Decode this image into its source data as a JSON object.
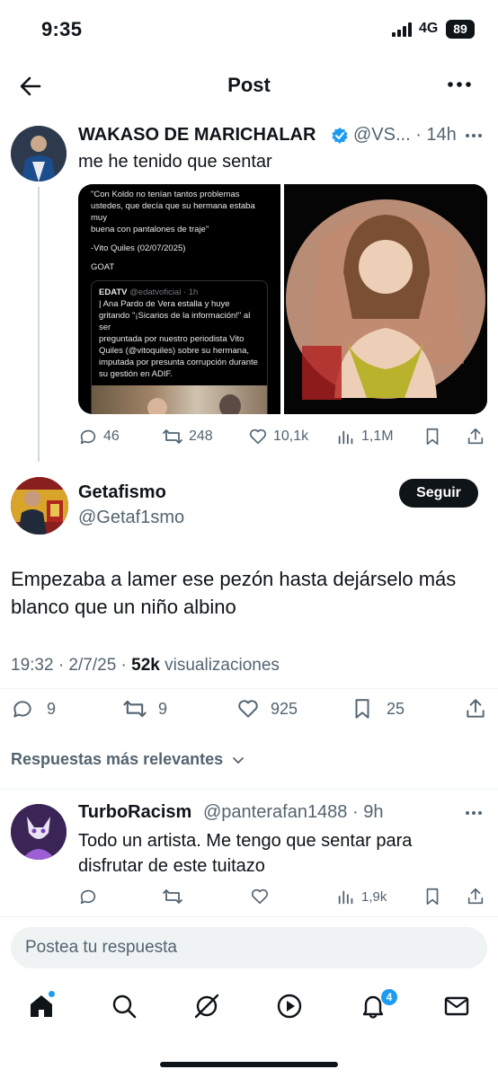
{
  "status_bar": {
    "time": "9:35",
    "network": "4G",
    "battery": "89"
  },
  "header": {
    "title": "Post"
  },
  "quoted_post": {
    "name": "WAKASO DE MARICHALAR",
    "handle_time": "@VS... · 14h",
    "text": "me he tenido que sentar",
    "media_text": {
      "quote_lines": [
        "\"Con Koldo no tenían tantos problemas",
        "ustedes, que decía que su hermana estaba muy",
        "buena con pantalones de traje\"",
        "",
        "-Vito Quiles (02/07/2025)",
        "",
        "GOAT"
      ],
      "card_author": "EDATV",
      "card_handle": "@edatvoficial · 1h",
      "card_lines": [
        "| Ana Pardo de Vera estalla y huye",
        "gritando \"¡Sicarios de la información!\" al ser",
        "preguntada por nuestro periodista Vito",
        "Quiles (@vitoquiles) sobre su hermana,",
        "imputada por presunta corrupción durante",
        "su gestión en ADIF."
      ]
    },
    "stats": {
      "replies": "46",
      "reposts": "248",
      "likes": "10,1k",
      "views": "1,1M"
    }
  },
  "main_post": {
    "name": "Getafismo",
    "handle": "@Getaf1smo",
    "follow_label": "Seguir",
    "text": "Empezaba a lamer ese pezón hasta dejárselo más blanco que un niño albino",
    "meta_prefix": "19:32 · 2/7/25 · ",
    "views_count": "52k",
    "views_label": " visualizaciones",
    "stats": {
      "replies": "9",
      "reposts": "9",
      "likes": "925",
      "bookmarks": "25"
    }
  },
  "replies_sort": {
    "label": "Respuestas más relevantes"
  },
  "reply": {
    "name": "TurboRacism",
    "handle_time": "@panterafan1488 · 9h",
    "text": "Todo un artista. Me tengo que sentar para disfrutar de este tuitazo",
    "stats": {
      "views": "1,9k"
    }
  },
  "compose": {
    "placeholder": "Postea tu respuesta"
  },
  "bottom_nav": {
    "notifications_badge": "4"
  },
  "colors": {
    "accent": "#1d9bf0",
    "text": "#0f1419",
    "muted": "#536471"
  }
}
